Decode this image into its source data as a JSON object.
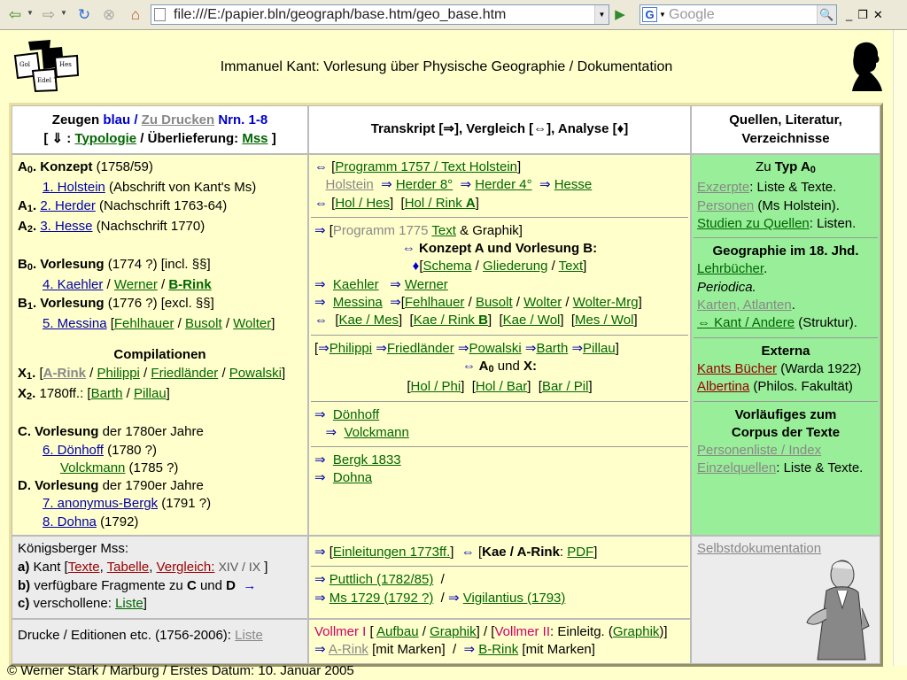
{
  "browser": {
    "url": "file:///E:/papier.bln/geograph/base.htm/geo_base.htm",
    "search_engine": "G",
    "search_placeholder": "Google",
    "icons": [
      "back-icon",
      "forward-icon",
      "reload-icon",
      "stop-icon",
      "home-icon",
      "go-icon",
      "search-icon",
      "minimize-icon",
      "restore-icon",
      "close-icon"
    ]
  },
  "page_title": "Immanuel Kant: Vorlesung über Physische Geographie / Dokumentation",
  "logo_left_text": [
    "Gol",
    "Edel 7",
    "Hes"
  ],
  "header": {
    "col1_line1": {
      "zeugen": "Zeugen",
      "blau": "blau /",
      "zu_drucken": "Zu Drucken",
      "nrn": "Nrn. 1-8"
    },
    "col1_line2": {
      "open": "[ ⇓ :",
      "typologie": "Typologie",
      "ueberlieferung": "/ Überlieferung:",
      "mss": "Mss",
      "close": "]"
    },
    "col2": "Transkript [⇒], Vergleich [⇔], Analyse [♦]",
    "col3_line1": "Quellen, Literatur,",
    "col3_line2": "Verzeichnisse"
  },
  "col1": {
    "a0_label": "A",
    "a0_sub": "0",
    "a0_title": ". Konzept",
    "a0_date": "(1758/59)",
    "holstein_link": "1. Holstein",
    "holstein_note": "(Abschrift von Kant's Ms)",
    "a1_label": "A",
    "a1_sub": "1",
    "a1_link": "2. Herder",
    "a1_note": "(Nachschrift 1763-64)",
    "a2_label": "A",
    "a2_sub": "2",
    "a2_link": "3. Hesse",
    "a2_note": "(Nachschrift 1770)",
    "b0_label": "B",
    "b0_sub": "0",
    "b0_title": ". Vorlesung",
    "b0_note": "(1774 ?) [incl. §§]",
    "kaehler_link": "4. Kaehler",
    "werner": "Werner",
    "brink": "B-Rink",
    "b1_label": "B",
    "b1_sub": "1",
    "b1_title": ". Vorlesung",
    "b1_note": "(1776 ?) [excl. §§]",
    "messina_link": "5. Messina",
    "fehlhauer": "Fehlhauer",
    "busolt": "Busolt",
    "wolter": "Wolter",
    "compilationen": "Compilationen",
    "x1_label": "X",
    "x1_sub": "1",
    "arink": "A-Rink",
    "philippi": "Philippi",
    "friedlaender": "Friedländer",
    "powalski": "Powalski",
    "x2_label": "X",
    "x2_sub": "2",
    "x2_date": "1780ff.:",
    "barth": "Barth",
    "pillau": "Pillau",
    "c_title": "C. Vorlesung",
    "c_note": "der 1780er Jahre",
    "doenhoff_link": "6. Dönhoff",
    "doenhoff_date": "(1780 ?)",
    "volckmann_link": "Volckmann",
    "volckmann_date": "(1785 ?)",
    "d_title": "D. Vorlesung",
    "d_note": "der 1790er Jahre",
    "bergk_link": "7. anonymus-Bergk",
    "bergk_date": "(1791 ?)",
    "dohna_link": "8. Dohna",
    "dohna_date": "(1792)"
  },
  "col2": {
    "programm1757": "Programm 1757 / Text Holstein",
    "holstein": "Holstein",
    "herder8": "Herder 8°",
    "herder4": "Herder 4°",
    "hesse": "Hesse",
    "holhes": "Hol / Hes",
    "holrink": "Hol / Rink ",
    "holrink_bold": "A",
    "programm1775_a": "Programm 1775",
    "programm1775_text": "Text",
    "programm1775_b": "& Graphik]",
    "konzept_line": "Konzept A und Vorlesung B:",
    "schema": "Schema",
    "gliederung": "Gliederung",
    "text": "Text",
    "kaehler": "Kaehler",
    "werner": "Werner",
    "messina": "Messina",
    "fehlhauer": "Fehlhauer",
    "busolt": "Busolt",
    "wolter": "Wolter",
    "wolter_mrg": "Wolter-Mrg",
    "kaemes": "Kae / Mes",
    "kaerink": "Kae / Rink ",
    "kaerink_bold": "B",
    "kaewol": "Kae / Wol",
    "meswol": "Mes / Wol",
    "philippi": "Philippi",
    "friedlaender": "Friedländer",
    "powalski": "Powalski",
    "barth": "Barth",
    "pillau": "Pillau",
    "a0x_a": "A",
    "a0x_sub": "0",
    "a0x_b": " und X:",
    "holphi": "Hol / Phi",
    "holbar": "Hol / Bar",
    "barpil": "Bar / Pil",
    "doenhoff": "Dönhoff",
    "volckmann": "Volckmann",
    "bergk1833": "Bergk 1833",
    "dohna": "Dohna"
  },
  "col3": {
    "zu_typ": "Zu",
    "typ": "Typ A",
    "typ_sub": "0",
    "exzerpte": "Exzerpte",
    "exzerpte_note": ": Liste & Texte.",
    "personen": "Personen",
    "personen_note": " (Ms Holstein).",
    "studien": "Studien zu Quellen",
    "studien_note": ": Listen.",
    "geo_title": "Geographie im 18. Jhd.",
    "lehrbuecher": "Lehrbücher",
    "periodica": "Periodica.",
    "karten": "Karten, Atlanten",
    "kant_andere": "⇔ Kant / Andere",
    "struktur": " (Struktur).",
    "externa": "Externa",
    "kants_buecher": "Kants Bücher",
    "warda": " (Warda 1922)",
    "albertina": "Albertina",
    "philos": " (Philos. Fakultät)",
    "vorl_title1": "Vorläufiges zum",
    "vorl_title2": "Corpus der Texte",
    "personenliste": "Personenliste / Index",
    "einzelquellen": "Einzelquellen",
    "einzel_note": ": Liste & Texte."
  },
  "bottom1": {
    "koenigsberger": "Königsberger Mss:",
    "a_label": "a)",
    "kant": "Kant [",
    "texte": "Texte",
    "tabelle": "Tabelle",
    "vergleich": "Vergleich:",
    "roman": "XIV / IX",
    "close": "]",
    "b_label": "b)",
    "b_text": "verfügbare Fragmente zu",
    "c_bold": "C",
    "und": "und",
    "d_bold": "D",
    "arrow": "→",
    "c_label": "c)",
    "c_text": "verschollene:",
    "liste": "Liste",
    "einleitungen": "Einleitungen 1773ff.",
    "kaearink": "Kae / A-Rink",
    "pdf": "PDF",
    "puttlich": "Puttlich (1782/85)",
    "ms1729": "Ms 1729 (1792 ?)",
    "vigilantius": "Vigilantius (1793)",
    "selbstdoku": "Selbstdokumentation"
  },
  "bottom2": {
    "drucke": "Drucke / Editionen etc. (1756-2006):",
    "liste": "Liste",
    "vollmer1": "Vollmer I",
    "aufbau": "Aufbau",
    "graphik": "Graphik",
    "vollmer2": "Vollmer II",
    "einleitg": ": Einleitg. (",
    "graphik2": "Graphik",
    "close": ")]",
    "arink": "A-Rink",
    "mitmarken": "[mit Marken]",
    "brink": "B-Rink",
    "mitmarken2": "[mit Marken]"
  },
  "footer": "© Werner Stark / Marburg / Erstes Datum: 10. Januar 2005"
}
